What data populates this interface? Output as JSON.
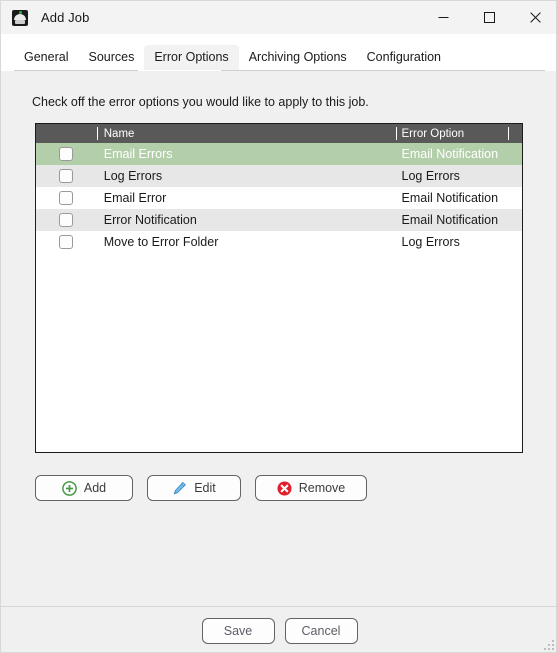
{
  "window": {
    "title": "Add Job",
    "icon": "app-dome-icon",
    "controls": {
      "minimize": "minimize-icon",
      "maximize": "maximize-icon",
      "close": "close-icon"
    }
  },
  "tabs": [
    {
      "label": "General",
      "active": false
    },
    {
      "label": "Sources",
      "active": false
    },
    {
      "label": "Error Options",
      "active": true
    },
    {
      "label": "Archiving Options",
      "active": false
    },
    {
      "label": "Configuration",
      "active": false
    }
  ],
  "content": {
    "instruction": "Check off the error options you would like to apply to this job."
  },
  "grid": {
    "columns": [
      {
        "key": "check",
        "label": ""
      },
      {
        "key": "name",
        "label": "Name"
      },
      {
        "key": "option",
        "label": "Error Option"
      },
      {
        "key": "tail",
        "label": ""
      }
    ],
    "rows": [
      {
        "checked": false,
        "name": "Email Errors",
        "option": "Email Notification",
        "selected": true,
        "alt": false
      },
      {
        "checked": false,
        "name": "Log Errors",
        "option": "Log Errors",
        "selected": false,
        "alt": true
      },
      {
        "checked": false,
        "name": "Email Error",
        "option": "Email Notification",
        "selected": false,
        "alt": false
      },
      {
        "checked": false,
        "name": "Error Notification",
        "option": "Email Notification",
        "selected": false,
        "alt": true
      },
      {
        "checked": false,
        "name": "Move to Error Folder",
        "option": "Log Errors",
        "selected": false,
        "alt": false
      }
    ]
  },
  "actions": {
    "add": {
      "label": "Add",
      "icon": "add-circle-icon"
    },
    "edit": {
      "label": "Edit",
      "icon": "pencil-icon"
    },
    "remove": {
      "label": "Remove",
      "icon": "remove-circle-icon"
    }
  },
  "footer": {
    "save": "Save",
    "cancel": "Cancel"
  },
  "colors": {
    "selection_green": "#b3cfaa",
    "header_gray": "#595959",
    "row_alt_gray": "#e7e7e7",
    "add_green": "#4a9a48",
    "edit_blue": "#51a7e0",
    "remove_red": "#e0202c",
    "window_bg": "#f0f0f0"
  }
}
